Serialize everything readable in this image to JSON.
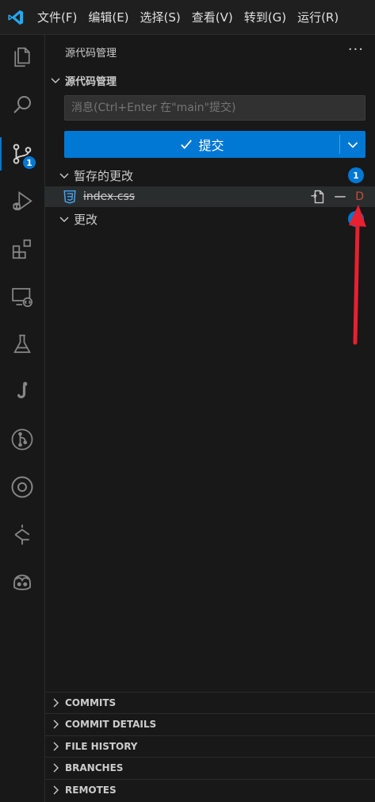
{
  "titlebar": {
    "menu": [
      "文件(F)",
      "编辑(E)",
      "选择(S)",
      "查看(V)",
      "转到(G)",
      "运行(R)"
    ]
  },
  "activitybar": {
    "items": [
      {
        "icon": "files-icon"
      },
      {
        "icon": "search-icon"
      },
      {
        "icon": "source-control-icon",
        "badge": "1"
      },
      {
        "icon": "run-debug-icon"
      },
      {
        "icon": "extensions-icon"
      },
      {
        "icon": "remote-explorer-icon"
      },
      {
        "icon": "testing-icon"
      },
      {
        "icon": "jupyter-icon"
      },
      {
        "icon": "git-graph-icon"
      },
      {
        "icon": "timeline-icon"
      },
      {
        "icon": "gitlens-icon"
      },
      {
        "icon": "copilot-icon"
      }
    ]
  },
  "sidebar": {
    "title": "源代码管理",
    "more": "···",
    "section_title": "源代码管理",
    "message_placeholder": "消息(Ctrl+Enter 在\"main\"提交)",
    "commit_label": "提交",
    "staged": {
      "label": "暂存的更改",
      "count": "1"
    },
    "file": {
      "name": "index.css",
      "status": "D"
    },
    "changes": {
      "label": "更改"
    },
    "panes": [
      "COMMITS",
      "COMMIT DETAILS",
      "FILE HISTORY",
      "BRANCHES",
      "REMOTES"
    ]
  },
  "colors": {
    "accent": "#0078d4",
    "deleted": "#c74e39",
    "annotation": "#e8202f"
  }
}
